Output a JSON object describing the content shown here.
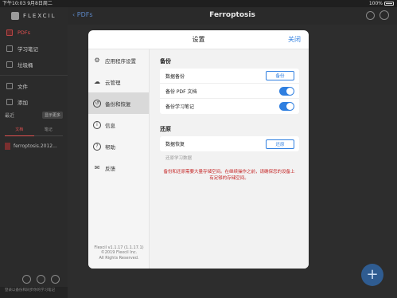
{
  "status_bar": {
    "time_date": "下午10:03  9月8日周二",
    "battery": "100%"
  },
  "sidebar": {
    "brand": "FLEXCIL",
    "items": [
      {
        "label": "PDFs",
        "icon": "pdf-icon"
      },
      {
        "label": "学习笔记",
        "icon": "notebook-icon"
      },
      {
        "label": "垃圾桶",
        "icon": "trash-icon"
      },
      {
        "label": "文件",
        "icon": "folder-icon"
      },
      {
        "label": "添加",
        "icon": "add-icon"
      }
    ],
    "recent_label": "最近",
    "recent_more": "显示更多",
    "tabs": [
      "文档",
      "笔记"
    ],
    "files": [
      "ferroptosis.2012..."
    ],
    "footer": "登录以备份和同步你的学习笔记"
  },
  "navbar": {
    "back": "PDFs",
    "title": "Ferroptosis"
  },
  "modal": {
    "title": "设置",
    "close": "关闭",
    "menu": [
      {
        "label": "应用程序设置",
        "icon": "gear-icon"
      },
      {
        "label": "云管理",
        "icon": "cloud-icon"
      },
      {
        "label": "备份和恢复",
        "icon": "backup-restore-icon"
      },
      {
        "label": "信息",
        "icon": "info-icon"
      },
      {
        "label": "帮助",
        "icon": "help-icon"
      },
      {
        "label": "反馈",
        "icon": "mail-icon"
      }
    ],
    "version": "Flexcil v1.1.17 (1.1.17.1)",
    "copyright": "©2019 Flexcil Inc.",
    "rights": "All Rights Reserved.",
    "backup": {
      "title": "备份",
      "rows": [
        {
          "label": "数据备份",
          "button": "备份"
        },
        {
          "label": "备份 PDF 文档",
          "toggle": true
        },
        {
          "label": "备份学习笔记",
          "toggle": true
        }
      ]
    },
    "restore": {
      "title": "还原",
      "row_label": "数据恢复",
      "button": "还原",
      "sub": "还原学习数据",
      "warning": "备份和还原需要大量存储空间。在继续操作之前，请确保您的设备上有足够的存储空间。"
    }
  },
  "colors": {
    "accent": "#2f7fe0",
    "warning": "#c62828",
    "brand_red": "#e05050"
  }
}
